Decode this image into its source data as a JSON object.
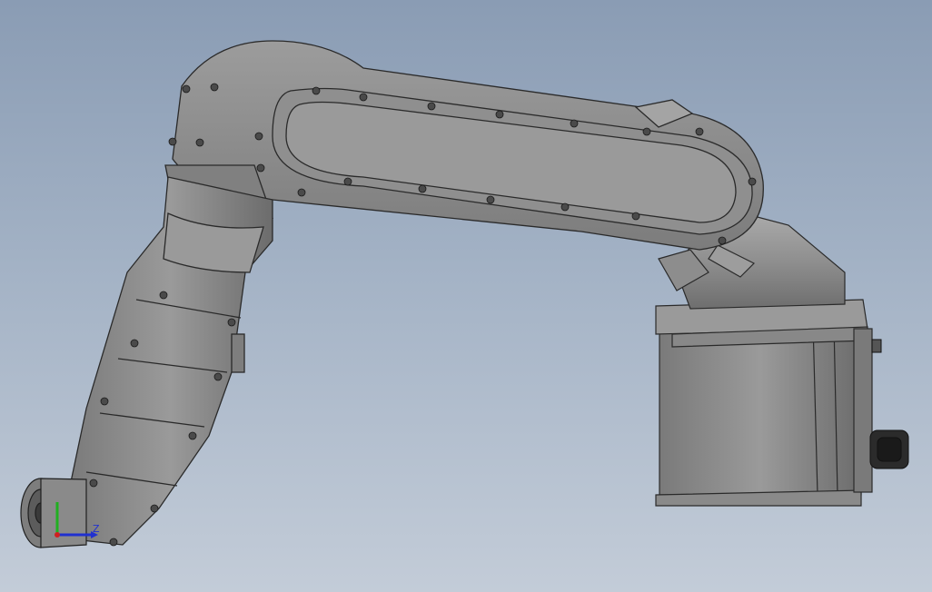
{
  "viewport": {
    "background_top": "#8a9cb4",
    "background_bottom": "#c3ccd8",
    "model_color": "#8c8c8c",
    "edge_color": "#2a2a2a"
  },
  "triad": {
    "label_z": "Z",
    "colors": {
      "x": "#d02020",
      "y": "#20b020",
      "z": "#2030d0"
    }
  }
}
